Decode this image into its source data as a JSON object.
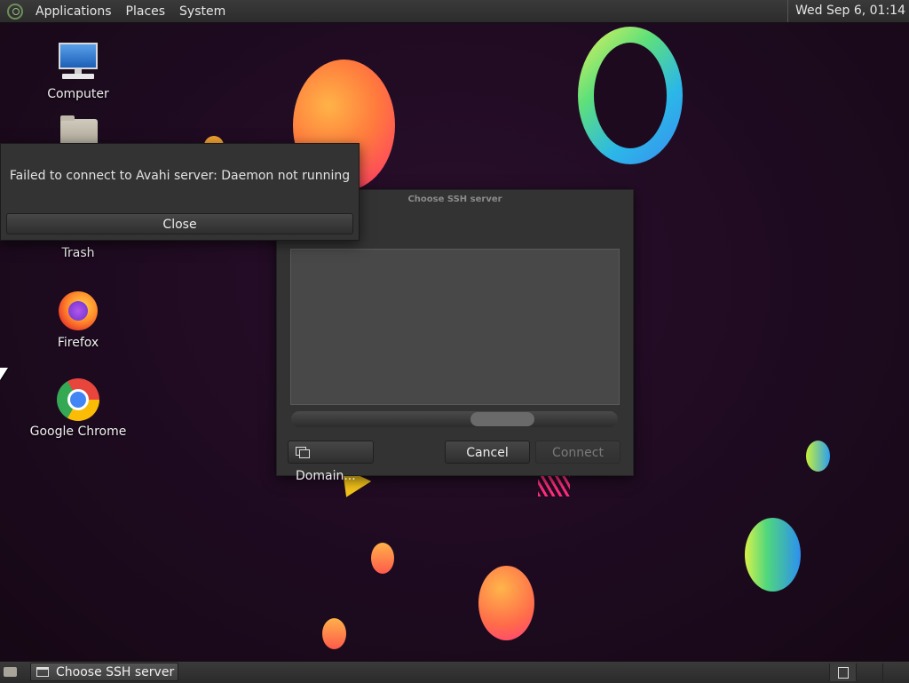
{
  "top_panel": {
    "menus": [
      "Applications",
      "Places",
      "System"
    ],
    "clock": "Wed Sep  6, 01:14"
  },
  "desktop": {
    "icons": [
      {
        "label": "Computer",
        "icon": "computer-icon"
      },
      {
        "label": "",
        "icon": "home-folder-icon"
      },
      {
        "label": "Trash",
        "icon": "trash-icon"
      },
      {
        "label": "Firefox",
        "icon": "firefox-icon"
      },
      {
        "label": "Google Chrome",
        "icon": "chrome-icon"
      }
    ]
  },
  "ssh_dialog": {
    "title": "Choose SSH server",
    "domain_button": "Domain...",
    "cancel_button": "Cancel",
    "connect_button": "Connect",
    "connect_enabled": false
  },
  "error_popup": {
    "message": "Failed to connect to Avahi server: Daemon not running",
    "close_button": "Close"
  },
  "bottom_panel": {
    "task": "Choose SSH server"
  },
  "colors": {
    "panel": "#2c2c2c",
    "dialog": "#333333",
    "wallpaper": "#1d0a1f"
  }
}
